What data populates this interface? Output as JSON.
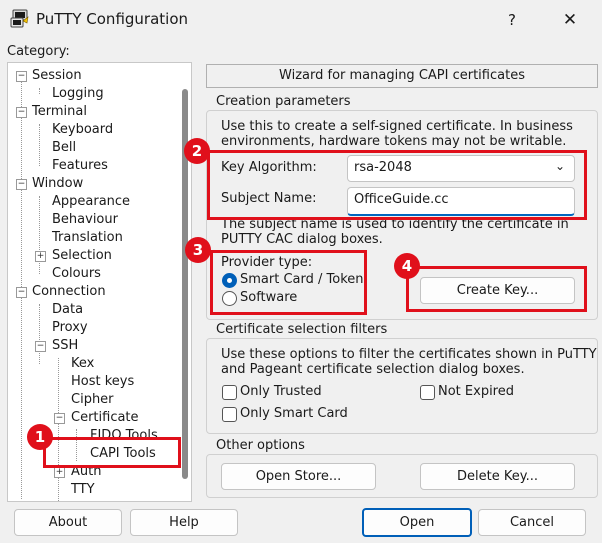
{
  "window": {
    "title": "PuTTY Configuration",
    "help": "?",
    "close": "✕"
  },
  "category_label": "Category:",
  "tree": {
    "items": [
      {
        "label": "Session"
      },
      {
        "label": "Logging"
      },
      {
        "label": "Terminal"
      },
      {
        "label": "Keyboard"
      },
      {
        "label": "Bell"
      },
      {
        "label": "Features"
      },
      {
        "label": "Window"
      },
      {
        "label": "Appearance"
      },
      {
        "label": "Behaviour"
      },
      {
        "label": "Translation"
      },
      {
        "label": "Selection"
      },
      {
        "label": "Colours"
      },
      {
        "label": "Connection"
      },
      {
        "label": "Data"
      },
      {
        "label": "Proxy"
      },
      {
        "label": "SSH"
      },
      {
        "label": "Kex"
      },
      {
        "label": "Host keys"
      },
      {
        "label": "Cipher"
      },
      {
        "label": "Certificate"
      },
      {
        "label": "FIDO Tools"
      },
      {
        "label": "CAPI Tools"
      },
      {
        "label": "Auth"
      },
      {
        "label": "TTY"
      }
    ]
  },
  "panel": {
    "header": "Wizard for managing CAPI certificates",
    "creation": {
      "title": "Creation parameters",
      "desc1": "Use this to create a self-signed certificate. In business",
      "desc2": "environments, hardware tokens may not be writable.",
      "key_algorithm_label": "Key Algorithm:",
      "key_algorithm_value": "rsa-2048",
      "subject_name_label": "Subject Name:",
      "subject_name_value": "OfficeGuide.cc",
      "subject_note1": "The subject name is used to identify the certificate in",
      "subject_note2": "PUTTY CAC dialog boxes.",
      "provider_label": "Provider type:",
      "provider_options": [
        {
          "label": "Smart Card / Token",
          "selected": true
        },
        {
          "label": "Software",
          "selected": false
        }
      ],
      "create_key_button": "Create Key..."
    },
    "filters": {
      "title": "Certificate selection filters",
      "desc1": "Use these options to filter the certificates shown in PuTTY",
      "desc2": "and Pageant certificate selection dialog boxes.",
      "only_trusted": "Only Trusted",
      "not_expired": "Not Expired",
      "only_smart_card": "Only Smart Card"
    },
    "other": {
      "title": "Other options",
      "open_store_button": "Open Store...",
      "delete_key_button": "Delete Key..."
    }
  },
  "footer": {
    "about": "About",
    "help": "Help",
    "open": "Open",
    "cancel": "Cancel"
  },
  "callouts": [
    "1",
    "2",
    "3",
    "4"
  ],
  "colors": {
    "callout_red": "#e0101b",
    "accent_blue": "#005fb8"
  }
}
